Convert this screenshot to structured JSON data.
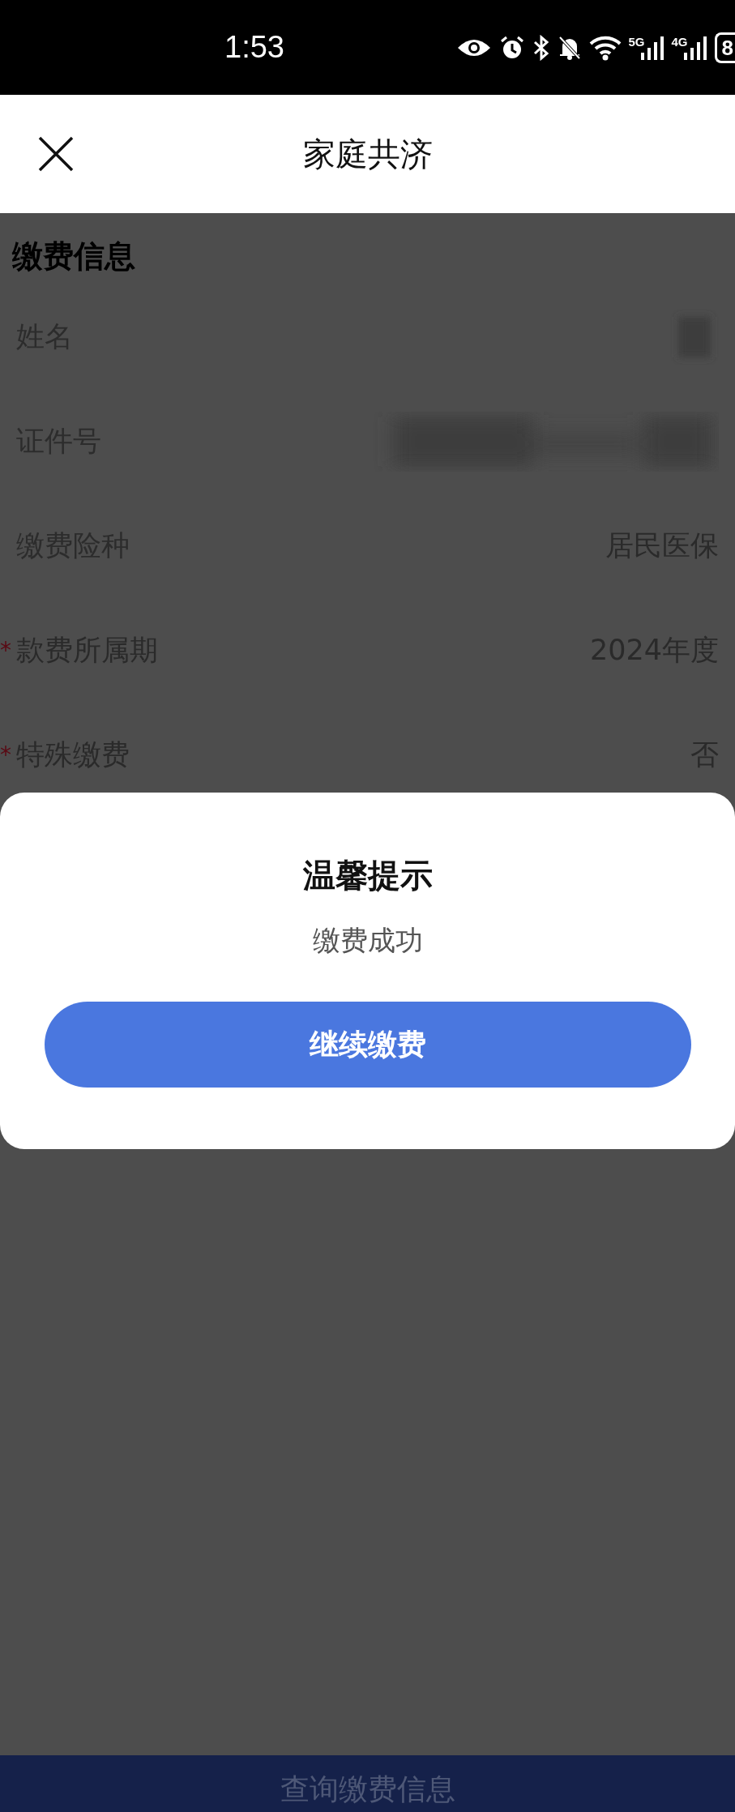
{
  "status_bar": {
    "time": "1:53",
    "network_labels": [
      "5G",
      "4G"
    ],
    "battery": "8"
  },
  "header": {
    "title": "家庭共济"
  },
  "section": {
    "title": "缴费信息"
  },
  "fields": [
    {
      "label": "姓名",
      "kind": "blurred"
    },
    {
      "label": "证件号",
      "kind": "blurred"
    },
    {
      "label": "缴费险种",
      "kind": "text",
      "value": "居民医保"
    },
    {
      "mark": "*",
      "label": "款费所属期",
      "kind": "text",
      "value": "2024年度"
    },
    {
      "mark": "*",
      "label": "特殊缴费",
      "kind": "text",
      "value": "否"
    }
  ],
  "dialog": {
    "title": "温馨提示",
    "message": "缴费成功",
    "button": "继续缴费"
  },
  "bottom_button": "查询缴费信息"
}
